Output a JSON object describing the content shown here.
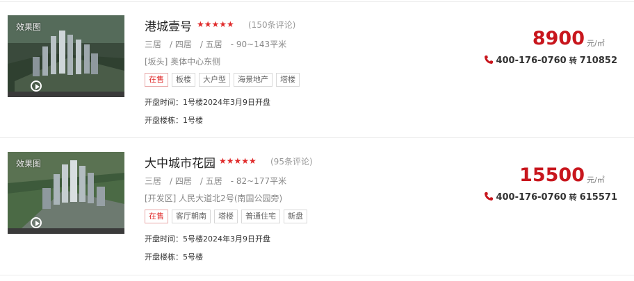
{
  "listings": [
    {
      "thumb_label": "效果图",
      "title": "港城壹号",
      "stars": "★★★★★",
      "reviews": "(150条评论)",
      "rooms": "三居　/ 四居　/ 五居　- 90~143平米",
      "address": "[坂头] 奥体中心东侧",
      "tags": [
        "在售",
        "板楼",
        "大户型",
        "海景地产",
        "塔楼"
      ],
      "open_time": "开盘时间：1号楼2024年3月9日开盘",
      "open_building": "开盘楼栋：1号楼",
      "price": "8900",
      "price_unit": "元/㎡",
      "phone": "400-176-0760",
      "ext_label": "转",
      "ext": "710852"
    },
    {
      "thumb_label": "效果图",
      "title": "大中城市花园",
      "stars": "★★★★★",
      "reviews": "(95条评论)",
      "rooms": "三居　/ 四居　/ 五居　- 82~177平米",
      "address": "[开发区] 人民大道北2号(南国公园旁)",
      "tags": [
        "在售",
        "客厅朝南",
        "塔楼",
        "普通住宅",
        "新盘"
      ],
      "open_time": "开盘时间：5号楼2024年3月9日开盘",
      "open_building": "开盘楼栋：5号楼",
      "price": "15500",
      "price_unit": "元/㎡",
      "phone": "400-176-0760",
      "ext_label": "转",
      "ext": "615571"
    }
  ],
  "colors": {
    "price": "#c8161d",
    "star": "#e02b2b",
    "tag_on": "#e02b2b"
  },
  "icons": {
    "phone": "phone-icon",
    "play": "play-icon"
  }
}
